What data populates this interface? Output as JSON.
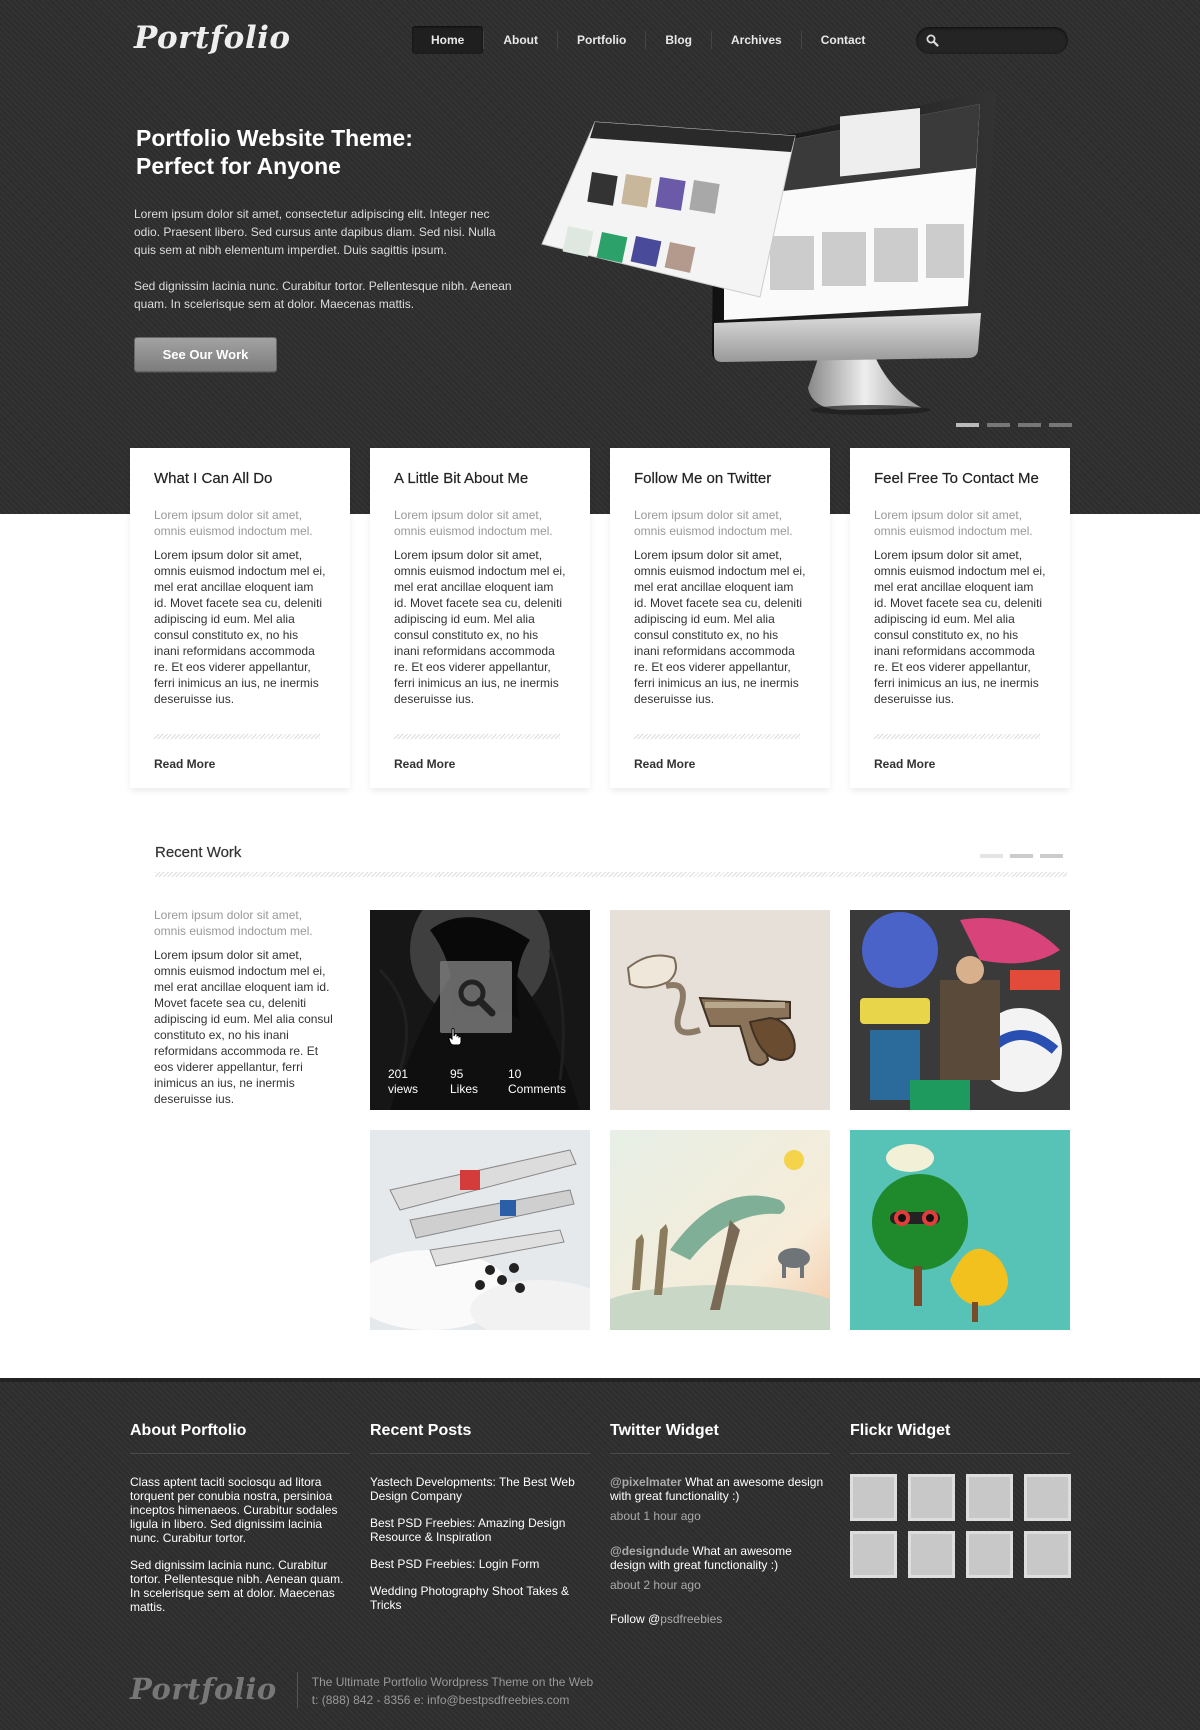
{
  "header": {
    "logo": "Portfolio",
    "nav": [
      {
        "label": "Home"
      },
      {
        "label": "About"
      },
      {
        "label": "Portfolio"
      },
      {
        "label": "Blog"
      },
      {
        "label": "Archives"
      },
      {
        "label": "Contact"
      }
    ],
    "active_nav": "Home",
    "search": {
      "placeholder": "",
      "icon": "search-icon"
    }
  },
  "hero": {
    "title_line1": "Portfolio Website Theme:",
    "title_line2": "Perfect for Anyone",
    "paragraph1": "Lorem ipsum dolor sit amet, consectetur adipiscing elit. Integer nec odio. Praesent libero. Sed cursus ante dapibus diam. Sed nisi. Nulla quis sem at nibh elementum imperdiet. Duis sagittis ipsum.",
    "paragraph2": "Sed dignissim lacinia nunc. Curabitur tortor. Pellentesque nibh. Aenean quam. In scelerisque sem at dolor. Maecenas mattis.",
    "cta": "See Our Work",
    "slides": 4,
    "active_slide": 1
  },
  "features": [
    {
      "title": "What I Can All Do",
      "lead": "Lorem ipsum dolor sit amet, omnis euismod indoctum mel.",
      "body": "Lorem ipsum dolor sit amet, omnis euismod indoctum mel ei, mel erat ancillae eloquent iam id. Movet facete sea cu, deleniti adipiscing id eum. Mel alia consul constituto ex, no his inani reformidans accommoda re. Et eos viderer appellantur, ferri inimicus an ius, ne inermis deseruisse ius.",
      "link": "Read More"
    },
    {
      "title": "A Little Bit About Me",
      "lead": "Lorem ipsum dolor sit amet, omnis euismod indoctum mel.",
      "body": "Lorem ipsum dolor sit amet, omnis euismod indoctum mel ei, mel erat ancillae eloquent iam id. Movet facete sea cu, deleniti adipiscing id eum. Mel alia consul constituto ex, no his inani reformidans accommoda re. Et eos viderer appellantur, ferri inimicus an ius, ne inermis deseruisse ius.",
      "link": "Read More"
    },
    {
      "title": "Follow Me on Twitter",
      "lead": "Lorem ipsum dolor sit amet, omnis euismod indoctum mel.",
      "body": "Lorem ipsum dolor sit amet, omnis euismod indoctum mel ei, mel erat ancillae eloquent iam id. Movet facete sea cu, deleniti adipiscing id eum. Mel alia consul constituto ex, no his inani reformidans accommoda re. Et eos viderer appellantur, ferri inimicus an ius, ne inermis deseruisse ius.",
      "link": "Read More"
    },
    {
      "title": "Feel Free To Contact Me",
      "lead": "Lorem ipsum dolor sit amet, omnis euismod indoctum mel.",
      "body": "Lorem ipsum dolor sit amet, omnis euismod indoctum mel ei, mel erat ancillae eloquent iam id. Movet facete sea cu, deleniti adipiscing id eum. Mel alia consul constituto ex, no his inani reformidans accommoda re. Et eos viderer appellantur, ferri inimicus an ius, ne inermis deseruisse ius.",
      "link": "Read More"
    }
  ],
  "recent_work": {
    "title": "Recent Work",
    "lead": "Lorem ipsum dolor sit amet, omnis euismod indoctum mel.",
    "body": "Lorem ipsum dolor sit amet, omnis euismod indoctum mel ei, mel erat ancillae eloquent iam id. Movet facete sea cu, deleniti adipiscing id eum. Mel alia consul constituto ex, no his inani reformidans accommoda re. Et eos viderer appellantur, ferri inimicus an ius, ne inermis deseruisse ius.",
    "pages": 3,
    "hover_stats": [
      {
        "value": "201",
        "label": "views"
      },
      {
        "value": "95",
        "label": "Likes"
      },
      {
        "value": "10",
        "label": "Comments"
      }
    ],
    "thumbs": [
      {
        "name": "dark-hair-artwork"
      },
      {
        "name": "bang-pistol-artwork"
      },
      {
        "name": "sticker-collage-artwork"
      },
      {
        "name": "airplanes-artwork"
      },
      {
        "name": "giraffes-desert-artwork"
      },
      {
        "name": "tree-character-artwork"
      }
    ]
  },
  "footer": {
    "about": {
      "title": "About Porftolio",
      "p1": "Class aptent taciti sociosqu ad litora torquent per conubia nostra, persinioa inceptos himenaeos. Curabitur sodales ligula in libero. Sed dignissim lacinia nunc. Curabitur tortor.",
      "p2": "Sed dignissim lacinia nunc. Curabitur tortor. Pellentesque nibh. Aenean quam. In scelerisque sem at dolor. Maecenas mattis."
    },
    "posts": {
      "title": "Recent Posts",
      "items": [
        "Yastech Developments: The Best Web Design Company",
        "Best PSD Freebies: Amazing Design Resource & Inspiration",
        "Best PSD Freebies: Login Form",
        "Wedding Photography Shoot Takes & Tricks"
      ]
    },
    "twitter": {
      "title": "Twitter Widget",
      "tweets": [
        {
          "handle": "@pixelmater",
          "text": " What an awesome design with great functionality :)",
          "time": "about 1 hour ago"
        },
        {
          "handle": "@designdude",
          "text": " What an awesome design with great functionality :)",
          "time": "about 2 hour ago"
        }
      ],
      "follow_prefix": "Follow ",
      "follow_at": "@",
      "follow_handle": "psdfreebies"
    },
    "flickr": {
      "title": "Flickr Widget",
      "count": 8
    },
    "bottom": {
      "logo": "Portfolio",
      "tagline": "The Ultimate Portfolio  Wordpress Theme on the Web",
      "contact": "t: (888) 842 - 8356  e: info@bestpsdfreebies.com"
    }
  }
}
